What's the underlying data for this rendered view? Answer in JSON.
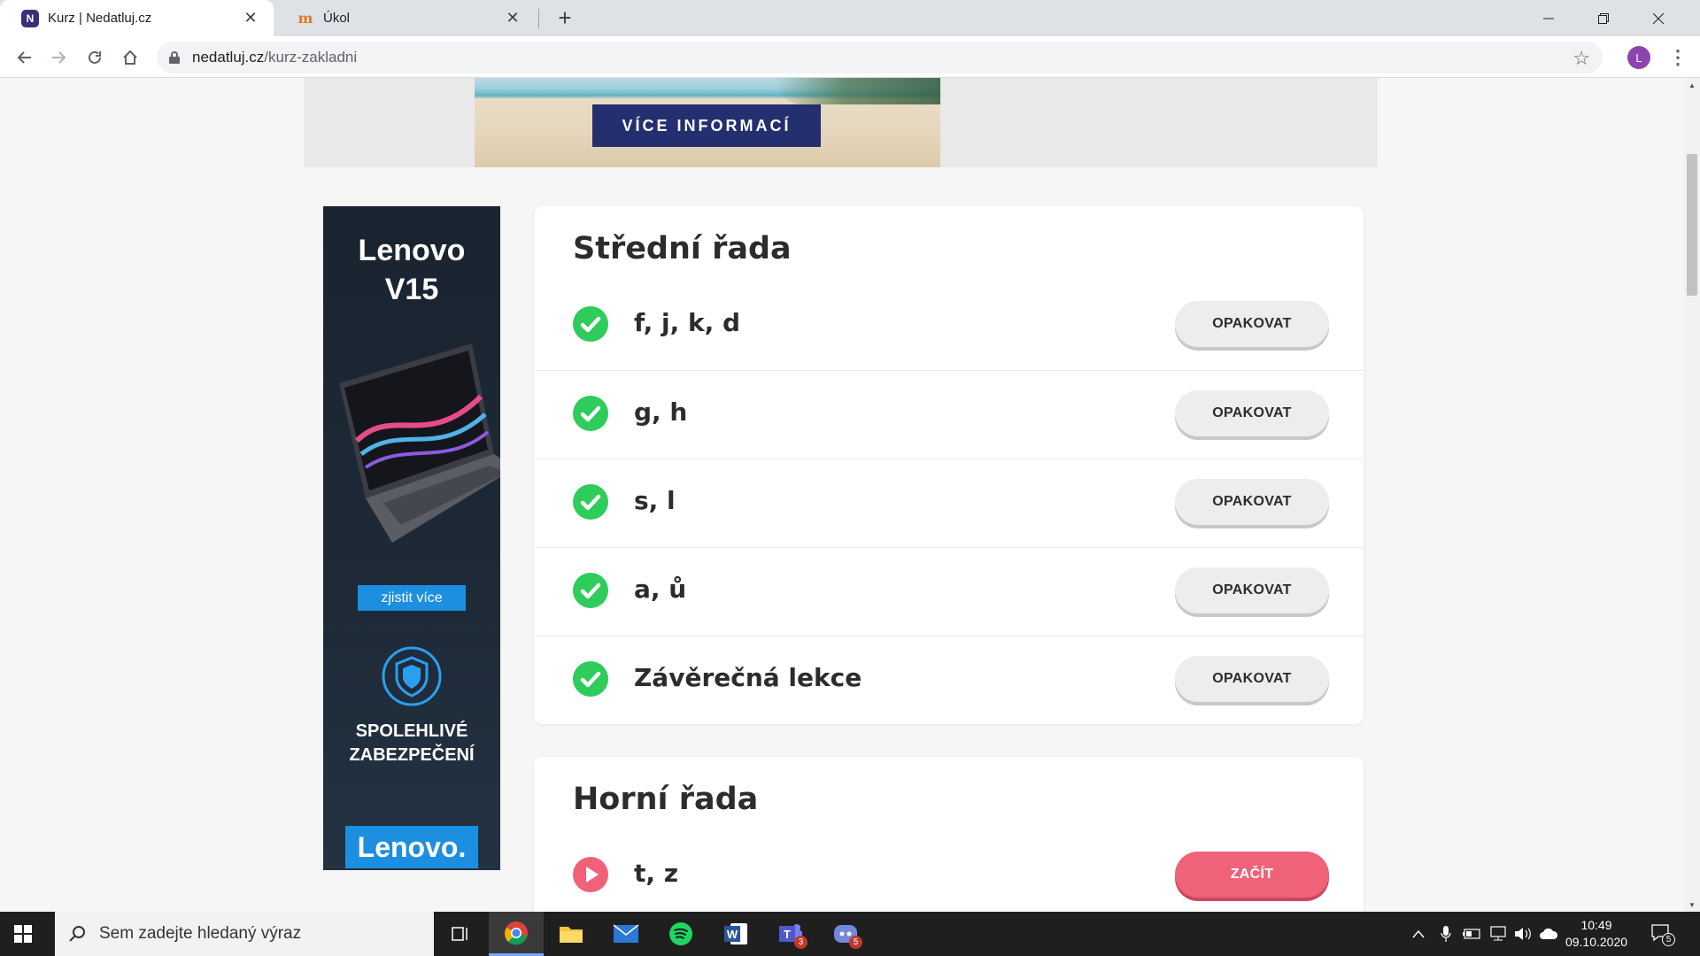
{
  "browser": {
    "tabs": [
      {
        "title": "Kurz | Nedatluj.cz",
        "favicon": "N"
      },
      {
        "title": "Úkol",
        "favicon": "m"
      }
    ],
    "url_host": "nedatluj.cz",
    "url_path": "/kurz-zakladni",
    "profile_initial": "L"
  },
  "top_ad": {
    "button": "VÍCE INFORMACÍ"
  },
  "side_ad": {
    "title_line1": "Lenovo",
    "title_line2": "V15",
    "cta": "zjistit více",
    "security_line1": "SPOLEHLIVÉ",
    "security_line2": "ZABEZPEČENÍ",
    "logo": "Lenovo."
  },
  "sections": [
    {
      "title": "Střední řada",
      "lessons": [
        {
          "label": "f, j, k, d",
          "status": "done",
          "button": "OPAKOVAT"
        },
        {
          "label": "g, h",
          "status": "done",
          "button": "OPAKOVAT"
        },
        {
          "label": "s, l",
          "status": "done",
          "button": "OPAKOVAT"
        },
        {
          "label": "a, ů",
          "status": "done",
          "button": "OPAKOVAT"
        },
        {
          "label": "Závěrečná lekce",
          "status": "done",
          "button": "OPAKOVAT"
        }
      ]
    },
    {
      "title": "Horní řada",
      "lessons": [
        {
          "label": "t, z",
          "status": "next",
          "button": "ZAČÍT"
        }
      ]
    }
  ],
  "colors": {
    "done": "#2ecc5a",
    "next": "#f06279"
  },
  "taskbar": {
    "search_placeholder": "Sem zadejte hledaný výraz",
    "apps": [
      "task-view",
      "chrome",
      "file-explorer",
      "mail",
      "spotify",
      "word",
      "teams",
      "discord"
    ],
    "teams_badge": "3",
    "discord_badge": "5",
    "time": "10:49",
    "date": "09.10.2020",
    "notifications": "5"
  }
}
